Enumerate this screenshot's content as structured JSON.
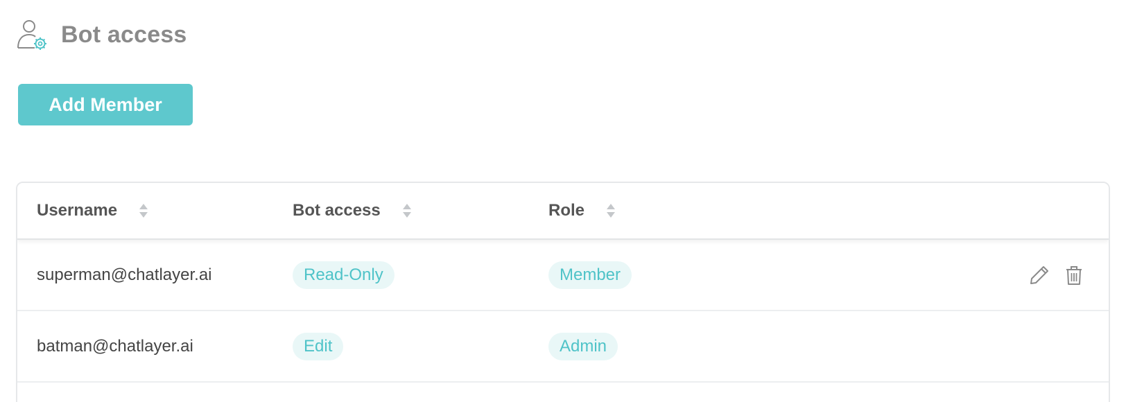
{
  "page": {
    "title": "Bot access",
    "icon": "user-settings-icon"
  },
  "toolbar": {
    "add_member_label": "Add Member"
  },
  "colors": {
    "accent": "#5ec8cd",
    "tag_bg": "#e9f7f7",
    "tag_text": "#4fc3c8",
    "title_text": "#8a8a8a"
  },
  "table": {
    "columns": [
      {
        "label": "Username",
        "sortable": true
      },
      {
        "label": "Bot access",
        "sortable": true
      },
      {
        "label": "Role",
        "sortable": true
      }
    ],
    "rows": [
      {
        "username": "superman@chatlayer.ai",
        "bot_access": "Read-Only",
        "role": "Member",
        "actions": [
          "edit-icon",
          "trash-icon"
        ]
      },
      {
        "username": "batman@chatlayer.ai",
        "bot_access": "Edit",
        "role": "Admin",
        "actions": []
      }
    ]
  }
}
